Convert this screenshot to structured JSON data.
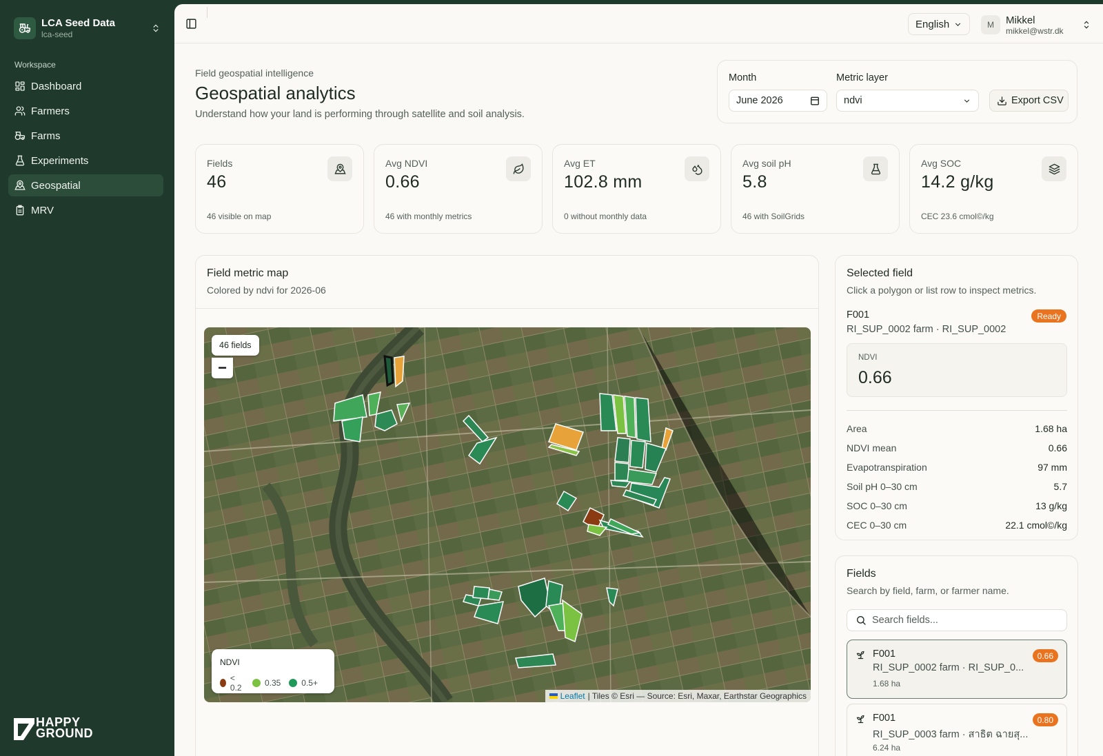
{
  "org": {
    "name": "LCA Seed Data",
    "slug": "lca-seed"
  },
  "nav": {
    "section": "Workspace",
    "items": [
      {
        "label": "Dashboard",
        "icon": "dashboard-icon"
      },
      {
        "label": "Farmers",
        "icon": "users-icon"
      },
      {
        "label": "Farms",
        "icon": "tractor-icon"
      },
      {
        "label": "Experiments",
        "icon": "flask-icon"
      },
      {
        "label": "Geospatial",
        "icon": "map-pin-icon",
        "active": true
      },
      {
        "label": "MRV",
        "icon": "clipboard-icon"
      }
    ]
  },
  "brand": {
    "line1": "HAPPY",
    "line2": "GROUND"
  },
  "topbar": {
    "language": "English",
    "user": {
      "initial": "M",
      "name": "Mikkel",
      "email": "mikkel@wstr.dk"
    }
  },
  "header": {
    "eyebrow": "Field geospatial intelligence",
    "title": "Geospatial analytics",
    "subtitle": "Understand how your land is performing through satellite and soil analysis."
  },
  "controls": {
    "month_label": "Month",
    "month_value": "June 2026",
    "metric_label": "Metric layer",
    "metric_value": "ndvi",
    "export_label": "Export CSV"
  },
  "stats": [
    {
      "label": "Fields",
      "value": "46",
      "note": "46 visible on map",
      "icon": "map-pin-icon"
    },
    {
      "label": "Avg NDVI",
      "value": "0.66",
      "note": "46 with monthly metrics",
      "icon": "leaf-icon"
    },
    {
      "label": "Avg ET",
      "value": "102.8 mm",
      "note": "0 without monthly data",
      "icon": "droplets-icon"
    },
    {
      "label": "Avg soil pH",
      "value": "5.8",
      "note": "46 with SoilGrids",
      "icon": "flask-icon"
    },
    {
      "label": "Avg SOC",
      "value": "14.2 g/kg",
      "note": "CEC 23.6 cmol©/kg",
      "icon": "layers-icon"
    }
  ],
  "map": {
    "title": "Field metric map",
    "subtitle": "Colored by ndvi for 2026-06",
    "fields_count": "46 fields",
    "zoom_out": "−",
    "legend": {
      "title": "NDVI",
      "items": [
        {
          "label": "< 0.2",
          "color": "#8a3b12"
        },
        {
          "label": "0.35",
          "color": "#7cc242"
        },
        {
          "label": "0.5+",
          "color": "#1f9a5a"
        }
      ]
    },
    "attribution": {
      "leaflet": "Leaflet",
      "rest": "| Tiles © Esri — Source: Esri, Maxar, Earthstar Geographics"
    }
  },
  "selected": {
    "title": "Selected field",
    "subtitle": "Click a polygon or list row to inspect metrics.",
    "id": "F001",
    "status": "Ready",
    "farm": "RI_SUP_0002 farm · RI_SUP_0002",
    "metric_label": "NDVI",
    "metric_value": "0.66",
    "rows": [
      {
        "label": "Area",
        "value": "1.68 ha"
      },
      {
        "label": "NDVI mean",
        "value": "0.66"
      },
      {
        "label": "Evapotranspiration",
        "value": "97 mm"
      },
      {
        "label": "Soil pH 0–30 cm",
        "value": "5.7"
      },
      {
        "label": "SOC 0–30 cm",
        "value": "13 g/kg"
      },
      {
        "label": "CEC 0–30 cm",
        "value": "22.1 cmol©/kg"
      }
    ]
  },
  "fields": {
    "title": "Fields",
    "subtitle": "Search by field, farm, or farmer name.",
    "search_placeholder": "Search fields...",
    "items": [
      {
        "id": "F001",
        "farm": "RI_SUP_0002 farm · RI_SUP_0...",
        "area": "1.68 ha",
        "value": "0.66",
        "active": true
      },
      {
        "id": "F001",
        "farm": "RI_SUP_0003 farm · สาธิต ฉายสุ...",
        "area": "6.24 ha",
        "value": "0.80",
        "active": false
      }
    ]
  },
  "colors": {
    "sidebar": "#1f3a2c",
    "accent_orange": "#e9731e",
    "page": "#faf9f5"
  }
}
